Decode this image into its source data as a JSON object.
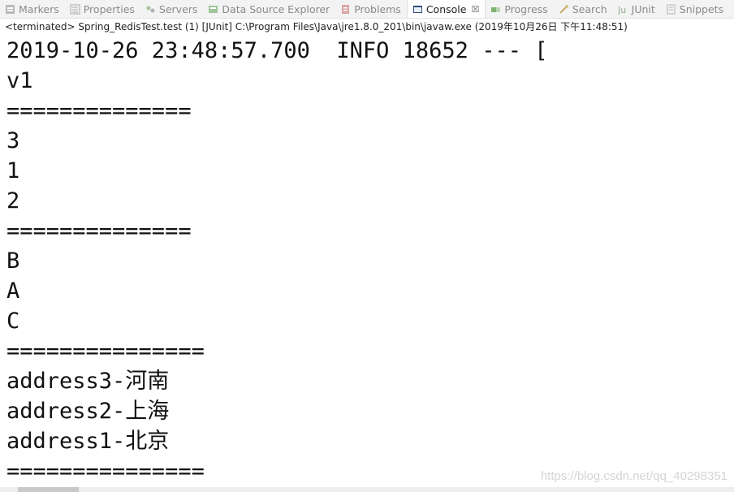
{
  "tabs": [
    {
      "label": "Markers",
      "icon": "markers-icon",
      "active": false
    },
    {
      "label": "Properties",
      "icon": "properties-icon",
      "active": false
    },
    {
      "label": "Servers",
      "icon": "servers-icon",
      "active": false
    },
    {
      "label": "Data Source Explorer",
      "icon": "data-source-icon",
      "active": false
    },
    {
      "label": "Problems",
      "icon": "problems-icon",
      "active": false
    },
    {
      "label": "Console",
      "icon": "console-icon",
      "active": true,
      "close": "☒"
    },
    {
      "label": "Progress",
      "icon": "progress-icon",
      "active": false
    },
    {
      "label": "Search",
      "icon": "search-icon",
      "active": false
    },
    {
      "label": "JUnit",
      "icon": "junit-icon",
      "active": false
    },
    {
      "label": "Snippets",
      "icon": "snippets-icon",
      "active": false
    }
  ],
  "status_line": "<terminated> Spring_RedisTest.test (1) [JUnit] C:\\Program Files\\Java\\jre1.8.0_201\\bin\\javaw.exe (2019年10月26日 下午11:48:51)",
  "console_lines": [
    "2019-10-26 23:48:57.700  INFO 18652 --- [",
    "v1",
    "==============",
    "3",
    "1",
    "2",
    "==============",
    "B",
    "A",
    "C",
    "===============",
    "address3-河南",
    "address2-上海",
    "address1-北京",
    "==============="
  ],
  "watermark": "https://blog.csdn.net/qq_40298351",
  "colors": {
    "tab_bar_bg": "#f3f3f3",
    "console_text": "#111111",
    "watermark": "#d4d4d4"
  }
}
